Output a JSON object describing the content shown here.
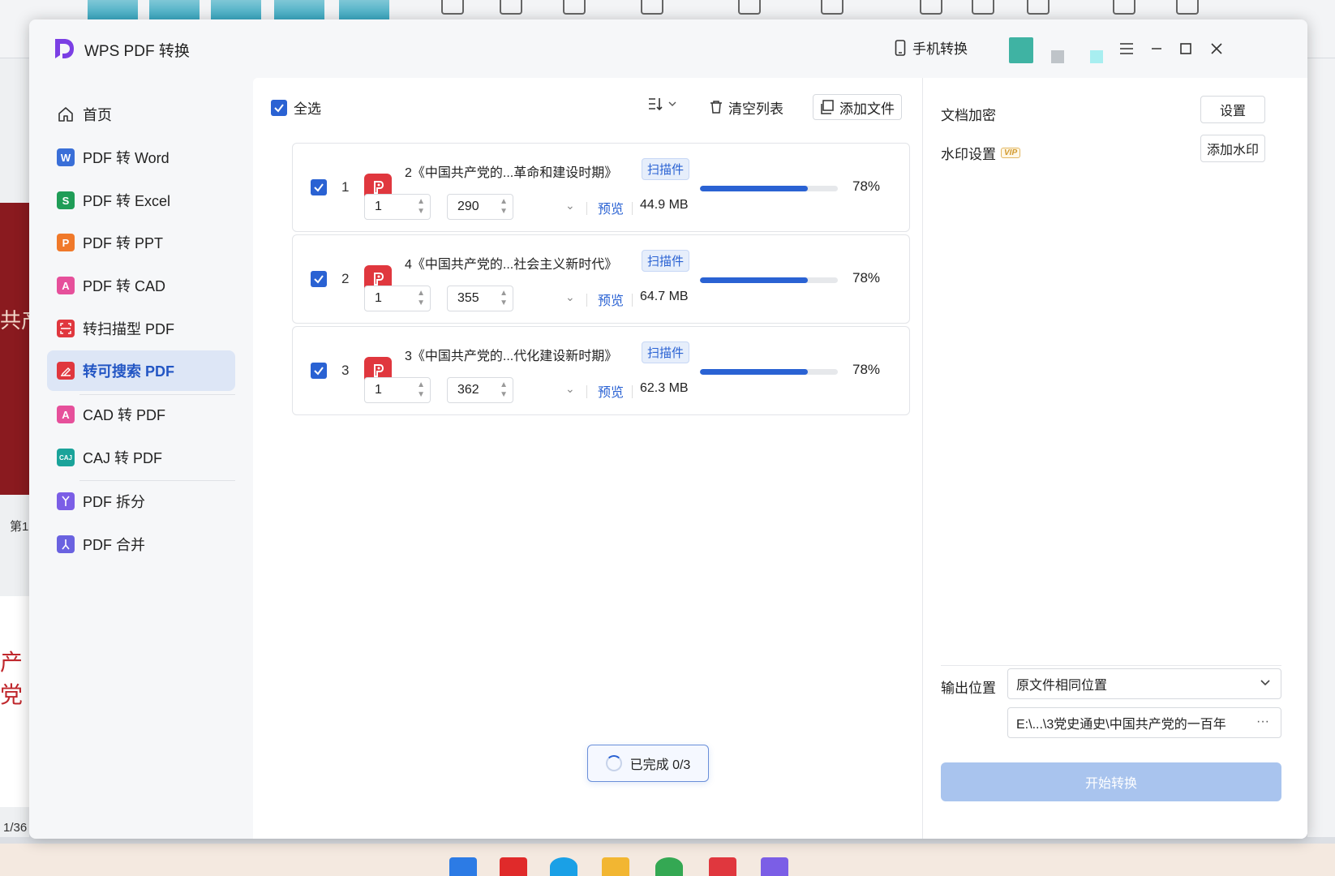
{
  "app": {
    "title": "WPS PDF 转换"
  },
  "header": {
    "mobile_convert": "手机转换"
  },
  "sidebar": {
    "items": [
      {
        "label": "首页",
        "icon": "home-icon"
      },
      {
        "label": "PDF 转 Word",
        "icon": "word-icon",
        "badge": "W",
        "color": "#3a6fd8"
      },
      {
        "label": "PDF 转 Excel",
        "icon": "excel-icon",
        "badge": "S",
        "color": "#1f9d57"
      },
      {
        "label": "PDF 转 PPT",
        "icon": "ppt-icon",
        "badge": "P",
        "color": "#f0792a"
      },
      {
        "label": "PDF 转 CAD",
        "icon": "cad-icon",
        "badge": "A",
        "color": "#e6509b"
      },
      {
        "label": "转扫描型 PDF",
        "icon": "scan-pdf-icon",
        "color": "#e0373e"
      },
      {
        "label": "转可搜索 PDF",
        "icon": "searchable-pdf-icon",
        "color": "#e0373e"
      },
      {
        "label": "CAD 转 PDF",
        "icon": "cad-to-pdf-icon",
        "badge": "A",
        "color": "#e6509b"
      },
      {
        "label": "CAJ 转 PDF",
        "icon": "caj-icon",
        "badge": "CAJ",
        "color": "#1aa39a"
      },
      {
        "label": "PDF 拆分",
        "icon": "split-icon",
        "color": "#7b5ee6"
      },
      {
        "label": "PDF 合并",
        "icon": "merge-icon",
        "color": "#6a62e0"
      }
    ],
    "active_index": 6
  },
  "toolbar": {
    "select_all": "全选",
    "clear_list": "清空列表",
    "add_file": "添加文件"
  },
  "files": [
    {
      "index": "1",
      "name": "2《中国共产党的...革命和建设时期》",
      "tag": "扫描件",
      "from": "1",
      "to": "290",
      "preview": "预览",
      "size": "44.9 MB",
      "progress": 78,
      "progress_label": "78%"
    },
    {
      "index": "2",
      "name": "4《中国共产党的...社会主义新时代》",
      "tag": "扫描件",
      "from": "1",
      "to": "355",
      "preview": "预览",
      "size": "64.7 MB",
      "progress": 78,
      "progress_label": "78%"
    },
    {
      "index": "3",
      "name": "3《中国共产党的...代化建设新时期》",
      "tag": "扫描件",
      "from": "1",
      "to": "362",
      "preview": "预览",
      "size": "62.3 MB",
      "progress": 78,
      "progress_label": "78%"
    }
  ],
  "status": {
    "done": "已完成 0/3"
  },
  "right_panel": {
    "encrypt_label": "文档加密",
    "encrypt_button": "设置",
    "watermark_label": "水印设置",
    "vip": "VIP",
    "watermark_button": "添加水印",
    "output_label": "输出位置",
    "output_option": "原文件相同位置",
    "output_path": "E:\\...\\3党史通史\\中国共产党的一百年",
    "more": "···",
    "start_button": "开始转换"
  },
  "background": {
    "page_indicator": "1/36",
    "page_label": "第1"
  }
}
